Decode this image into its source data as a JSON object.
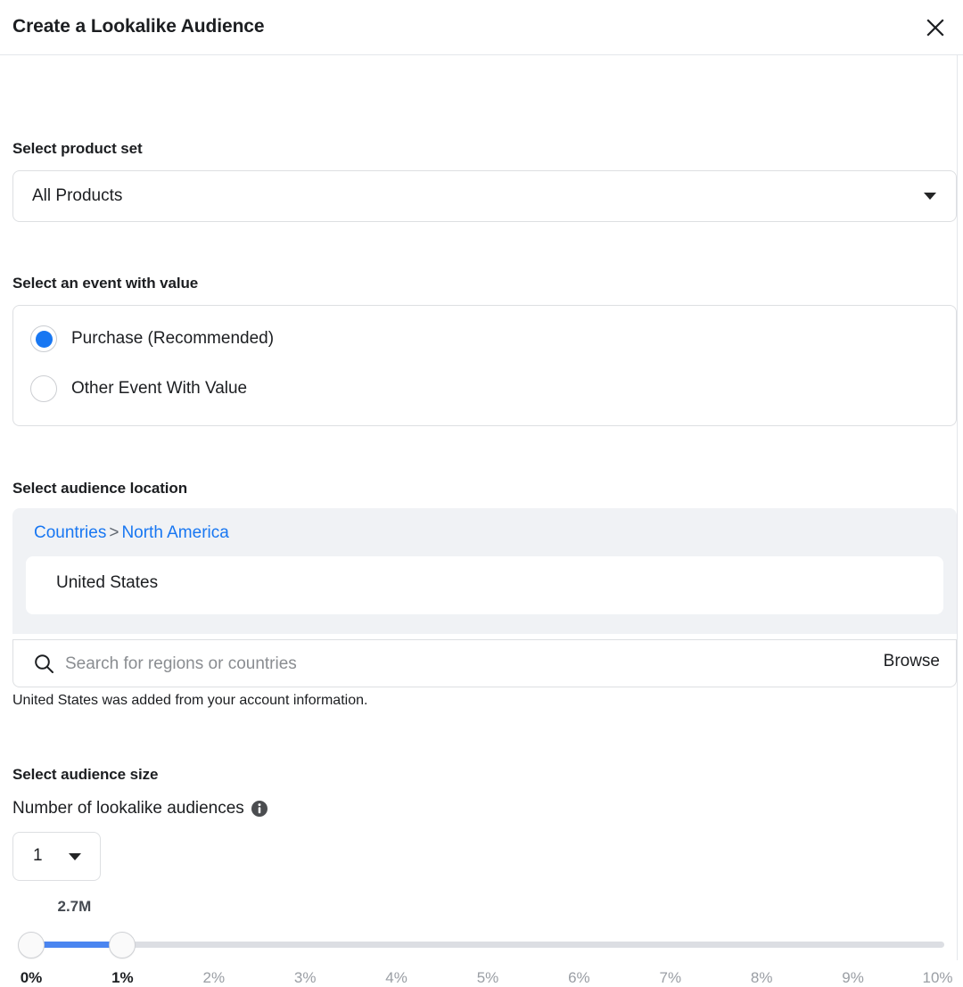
{
  "modal": {
    "title": "Create a Lookalike Audience",
    "close_icon": "close-icon"
  },
  "product_set": {
    "label": "Select product set",
    "selected": "All Products",
    "caret_icon": "chevron-down-icon"
  },
  "event": {
    "label": "Select an event with value",
    "options": [
      {
        "label": "Purchase (Recommended)",
        "checked": true
      },
      {
        "label": "Other Event With Value",
        "checked": false
      }
    ]
  },
  "location": {
    "label": "Select audience location",
    "breadcrumb": {
      "root": "Countries",
      "separator": ">",
      "current": "North America"
    },
    "selected_chip": "United States",
    "search_placeholder": "Search for regions or countries",
    "search_value": "",
    "search_icon": "search-icon",
    "browse_label": "Browse",
    "note": "United States was added from your account information."
  },
  "audience_size": {
    "label": "Select audience size",
    "number_label": "Number of lookalike audiences",
    "info_icon": "info-icon",
    "number_value": "1",
    "caret_icon": "chevron-down-icon",
    "slider": {
      "bubble_value": "2.7M",
      "range_start_percent": 0,
      "range_end_percent": 1,
      "min": 0,
      "max": 10,
      "ticks": [
        "0%",
        "1%",
        "2%",
        "3%",
        "4%",
        "5%",
        "6%",
        "7%",
        "8%",
        "9%",
        "10%"
      ],
      "active_ticks": [
        "0%",
        "1%"
      ]
    }
  },
  "colors": {
    "accent_blue": "#1877f2",
    "slider_fill": "#4a85f0",
    "link_blue": "#1877f2",
    "panel_grey": "#f0f2f5",
    "border_grey": "#dddfe2",
    "text_primary": "#1c1e21",
    "text_muted": "#9a9ea4"
  }
}
